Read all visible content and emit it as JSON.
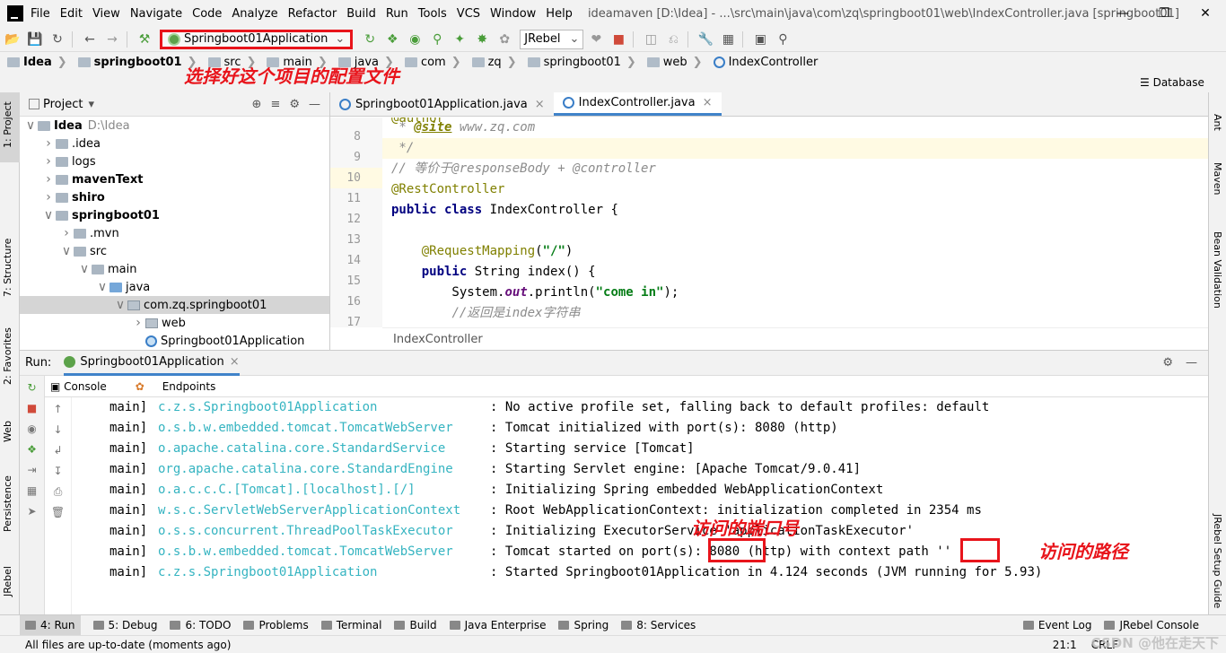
{
  "app": {
    "menus": [
      "File",
      "Edit",
      "View",
      "Navigate",
      "Code",
      "Analyze",
      "Refactor",
      "Build",
      "Run",
      "Tools",
      "VCS",
      "Window",
      "Help"
    ],
    "window_title": "ideamaven [D:\\Idea] - ...\\src\\main\\java\\com\\zq\\springboot01\\web\\IndexController.java [springboot01]",
    "win_controls": [
      "—",
      "❐",
      "✕"
    ]
  },
  "toolbar": {
    "run_config": "Springboot01Application",
    "jrebel": "JRebel"
  },
  "breadcrumbs": [
    "Idea",
    "springboot01",
    "src",
    "main",
    "java",
    "com",
    "zq",
    "springboot01",
    "web",
    "IndexController"
  ],
  "annotation_config": "选择好这个项目的配置文件",
  "annotation_port": "访问的端口号",
  "annotation_path": "访问的路径",
  "left_tabs": [
    "1: Project",
    "7: Structure",
    "2: Favorites",
    "Web",
    "Persistence",
    "JRebel"
  ],
  "right_tabs": [
    "Ant",
    "Maven",
    "Bean Validation",
    "JRebel Setup Guide"
  ],
  "database_label": "Database",
  "project": {
    "header": "Project",
    "tree": [
      {
        "label": "Idea",
        "extra": "D:\\Idea",
        "bold": true,
        "depth": 0,
        "arrow": "▼",
        "kind": "fld"
      },
      {
        "label": ".idea",
        "depth": 1,
        "arrow": "▶",
        "kind": "fld"
      },
      {
        "label": "logs",
        "depth": 1,
        "arrow": "▶",
        "kind": "fld"
      },
      {
        "label": "mavenText",
        "bold": true,
        "depth": 1,
        "arrow": "▶",
        "kind": "fld"
      },
      {
        "label": "shiro",
        "bold": true,
        "depth": 1,
        "arrow": "▶",
        "kind": "fld"
      },
      {
        "label": "springboot01",
        "bold": true,
        "depth": 1,
        "arrow": "▼",
        "kind": "fld"
      },
      {
        "label": ".mvn",
        "depth": 2,
        "arrow": "▶",
        "kind": "fld"
      },
      {
        "label": "src",
        "depth": 2,
        "arrow": "▼",
        "kind": "fld"
      },
      {
        "label": "main",
        "depth": 3,
        "arrow": "▼",
        "kind": "fld"
      },
      {
        "label": "java",
        "depth": 4,
        "arrow": "▼",
        "kind": "blue"
      },
      {
        "label": "com.zq.springboot01",
        "depth": 5,
        "arrow": "▼",
        "kind": "pkg",
        "selected": true
      },
      {
        "label": "web",
        "depth": 6,
        "arrow": "▶",
        "kind": "pkg"
      },
      {
        "label": "Springboot01Application",
        "depth": 6,
        "arrow": "",
        "kind": "jv"
      }
    ]
  },
  "editor": {
    "tabs": [
      {
        "label": "Springboot01Application.java",
        "active": false
      },
      {
        "label": "IndexController.java",
        "active": true
      }
    ],
    "line_numbers": [
      "8",
      "9",
      "10",
      "11",
      "12",
      "13",
      "14",
      "15",
      "16",
      "17"
    ],
    "footer": "IndexController"
  },
  "run": {
    "label": "Run:",
    "tab": "Springboot01Application",
    "subtabs": [
      "Console",
      "Endpoints"
    ],
    "thread": "main]",
    "logs": [
      {
        "logger": "c.z.s.Springboot01Application",
        "msg": ": No active profile set, falling back to default profiles: default"
      },
      {
        "logger": "o.s.b.w.embedded.tomcat.TomcatWebServer",
        "msg": ": Tomcat initialized with port(s): 8080 (http)"
      },
      {
        "logger": "o.apache.catalina.core.StandardService",
        "msg": ": Starting service [Tomcat]"
      },
      {
        "logger": "org.apache.catalina.core.StandardEngine",
        "msg": ": Starting Servlet engine: [Apache Tomcat/9.0.41]"
      },
      {
        "logger": "o.a.c.c.C.[Tomcat].[localhost].[/]",
        "msg": ": Initializing Spring embedded WebApplicationContext"
      },
      {
        "logger": "w.s.c.ServletWebServerApplicationContext",
        "msg": ": Root WebApplicationContext: initialization completed in 2354 ms"
      },
      {
        "logger": "o.s.s.concurrent.ThreadPoolTaskExecutor",
        "msg": ": Initializing ExecutorService 'applicationTaskExecutor'"
      },
      {
        "logger": "o.s.b.w.embedded.tomcat.TomcatWebServer",
        "msg": ": Tomcat started on port(s): 8080 (http) with context path ''"
      },
      {
        "logger": "c.z.s.Springboot01Application",
        "msg": ": Started Springboot01Application in 4.124 seconds (JVM running for 5.93)"
      }
    ]
  },
  "bottom_tabs": [
    "4: Run",
    "5: Debug",
    "6: TODO",
    "Problems",
    "Terminal",
    "Build",
    "Java Enterprise",
    "Spring",
    "8: Services",
    "Event Log",
    "JRebel Console"
  ],
  "status": {
    "text": "All files are up-to-date (moments ago)",
    "pos": "21:1",
    "enc": "CRLF",
    "watermark": "CSDN @他在走天下"
  },
  "colors": {
    "annotation": "#e8141b",
    "logger": "#35b4c1",
    "accent": "#4083c9"
  }
}
